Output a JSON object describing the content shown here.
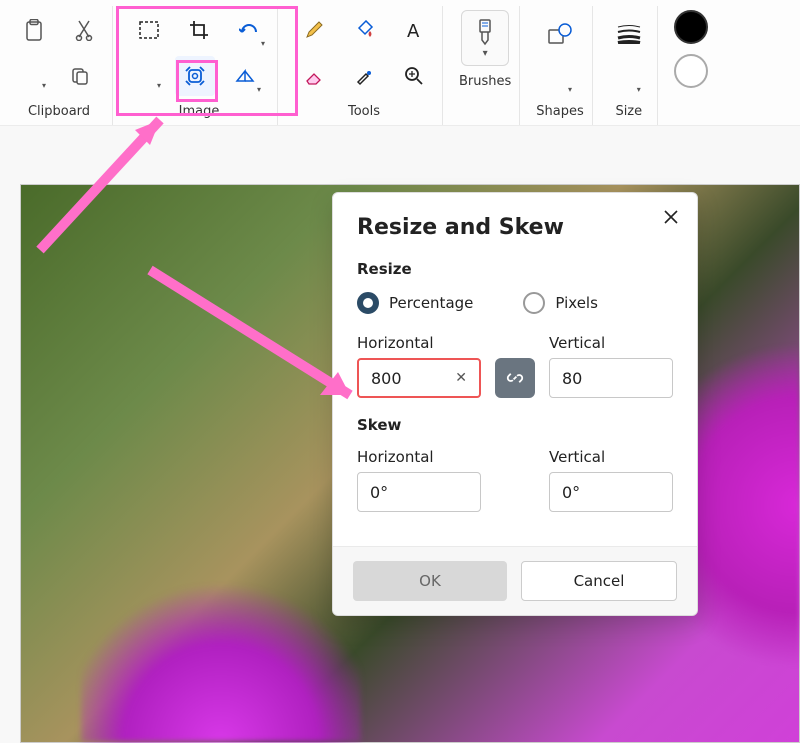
{
  "ribbon": {
    "clipboard": {
      "label": "Clipboard"
    },
    "image": {
      "label": "Image"
    },
    "tools": {
      "label": "Tools"
    },
    "brushes": {
      "label": "Brushes"
    },
    "shapes": {
      "label": "Shapes"
    },
    "size": {
      "label": "Size"
    }
  },
  "dialog": {
    "title": "Resize and Skew",
    "resize": {
      "label": "Resize",
      "percentage_label": "Percentage",
      "pixels_label": "Pixels",
      "horizontal_label": "Horizontal",
      "vertical_label": "Vertical",
      "horizontal_value": "800",
      "vertical_value": "80",
      "selected_mode": "percentage"
    },
    "skew": {
      "label": "Skew",
      "horizontal_label": "Horizontal",
      "vertical_label": "Vertical",
      "horizontal_value": "0°",
      "vertical_value": "0°"
    },
    "ok_label": "OK",
    "cancel_label": "Cancel"
  },
  "annotation": {
    "highlight_color": "#ff5fd0",
    "arrow_color": "#ff7fd0"
  }
}
